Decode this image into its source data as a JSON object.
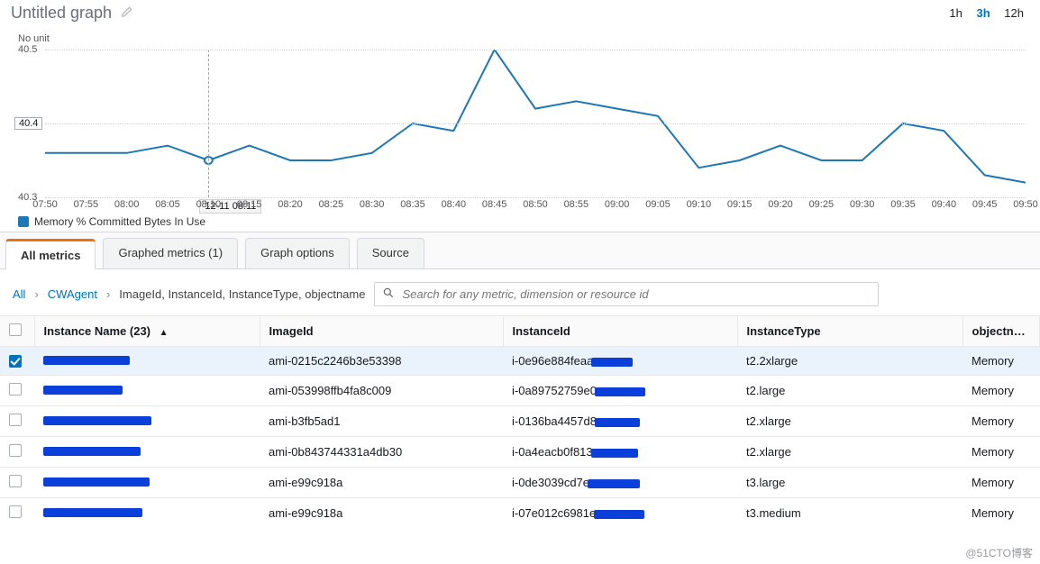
{
  "header": {
    "title": "Untitled graph",
    "ranges": [
      "1h",
      "3h",
      "12h"
    ],
    "active_range": "3h"
  },
  "chart_data": {
    "type": "line",
    "title": "",
    "ylabel": "No unit",
    "xlabel": "",
    "ylim": [
      40.3,
      40.5
    ],
    "yticks": [
      40.3,
      40.4,
      40.5
    ],
    "x": [
      "07:50",
      "07:55",
      "08:00",
      "08:05",
      "08:10",
      "08:15",
      "08:20",
      "08:25",
      "08:30",
      "08:35",
      "08:40",
      "08:45",
      "08:50",
      "08:55",
      "09:00",
      "09:05",
      "09:10",
      "09:15",
      "09:20",
      "09:25",
      "09:30",
      "09:35",
      "09:40",
      "09:45",
      "09:50"
    ],
    "series": [
      {
        "name": "Memory % Committed Bytes In Use",
        "color": "#1f77b4",
        "values": [
          40.36,
          40.36,
          40.36,
          40.37,
          40.35,
          40.37,
          40.35,
          40.35,
          40.36,
          40.4,
          40.39,
          40.5,
          40.42,
          40.43,
          40.42,
          40.41,
          40.34,
          40.35,
          40.37,
          40.35,
          40.35,
          40.4,
          40.39,
          40.33,
          40.32
        ]
      }
    ],
    "hover": {
      "index": 4,
      "label": "12-11 08:11",
      "yvalue_text": "40.4"
    },
    "legend_entries": [
      "Memory % Committed Bytes In Use"
    ]
  },
  "tabs": {
    "items": [
      {
        "id": "all-metrics",
        "label": "All metrics"
      },
      {
        "id": "graphed-metrics",
        "label": "Graphed metrics (1)"
      },
      {
        "id": "graph-options",
        "label": "Graph options"
      },
      {
        "id": "source",
        "label": "Source"
      }
    ],
    "active": "all-metrics"
  },
  "breadcrumb": {
    "root": "All",
    "namespace": "CWAgent",
    "dimensions": "ImageId, InstanceId, InstanceType, objectname"
  },
  "search": {
    "placeholder": "Search for any metric, dimension or resource id"
  },
  "table": {
    "columns": {
      "instance_name": "Instance Name",
      "instance_name_count": "(23)",
      "image_id": "ImageId",
      "instance_id": "InstanceId",
      "instance_type": "InstanceType",
      "object_name": "objectname"
    },
    "rows": [
      {
        "checked": true,
        "name_redacted": true,
        "name_width": 96,
        "image_id": "ami-0215c2246b3e53398",
        "instance_id_prefix": "i-0e96e884feaa",
        "instance_id_redact_w": 46,
        "instance_type": "t2.2xlarge",
        "object_name": "Memory"
      },
      {
        "checked": false,
        "name_redacted": true,
        "name_width": 88,
        "image_id": "ami-053998ffb4fa8c009",
        "instance_id_prefix": "i-0a89752759e0",
        "instance_id_redact_w": 56,
        "instance_type": "t2.large",
        "object_name": "Memory"
      },
      {
        "checked": false,
        "name_redacted": true,
        "name_width": 120,
        "image_id": "ami-b3fb5ad1",
        "instance_id_prefix": "i-0136ba4457d8",
        "instance_id_redact_w": 50,
        "instance_type": "t2.xlarge",
        "object_name": "Memory"
      },
      {
        "checked": false,
        "name_redacted": true,
        "name_width": 108,
        "image_id": "ami-0b843744331a4db30",
        "instance_id_prefix": "i-0a4eacb0f813",
        "instance_id_redact_w": 52,
        "instance_type": "t2.xlarge",
        "object_name": "Memory"
      },
      {
        "checked": false,
        "name_redacted": true,
        "name_width": 118,
        "image_id": "ami-e99c918a",
        "instance_id_prefix": "i-0de3039cd7e",
        "instance_id_redact_w": 58,
        "instance_type": "t3.large",
        "object_name": "Memory"
      },
      {
        "checked": false,
        "name_redacted": true,
        "name_width": 110,
        "image_id": "ami-e99c918a",
        "instance_id_prefix": "i-07e012c6981e",
        "instance_id_redact_w": 56,
        "instance_type": "t3.medium",
        "object_name": "Memory"
      }
    ]
  },
  "watermark": "@51CTO博客"
}
